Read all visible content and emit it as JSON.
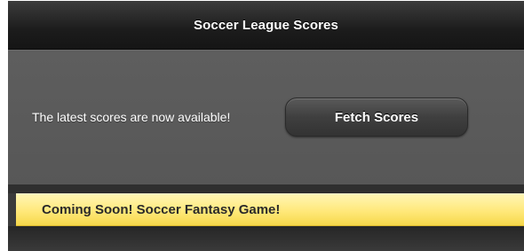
{
  "header": {
    "title": "Soccer League Scores"
  },
  "main": {
    "message": "The latest scores are now available!",
    "fetch_button_label": "Fetch Scores"
  },
  "banner": {
    "text": "Coming Soon! Soccer Fantasy Game!"
  },
  "colors": {
    "header_bg": "#1c1c1c",
    "content_bg": "#5b5b5b",
    "banner_bg": "#ffe87a",
    "text_light": "#ffffff",
    "text_dark": "#2a2a2a"
  }
}
